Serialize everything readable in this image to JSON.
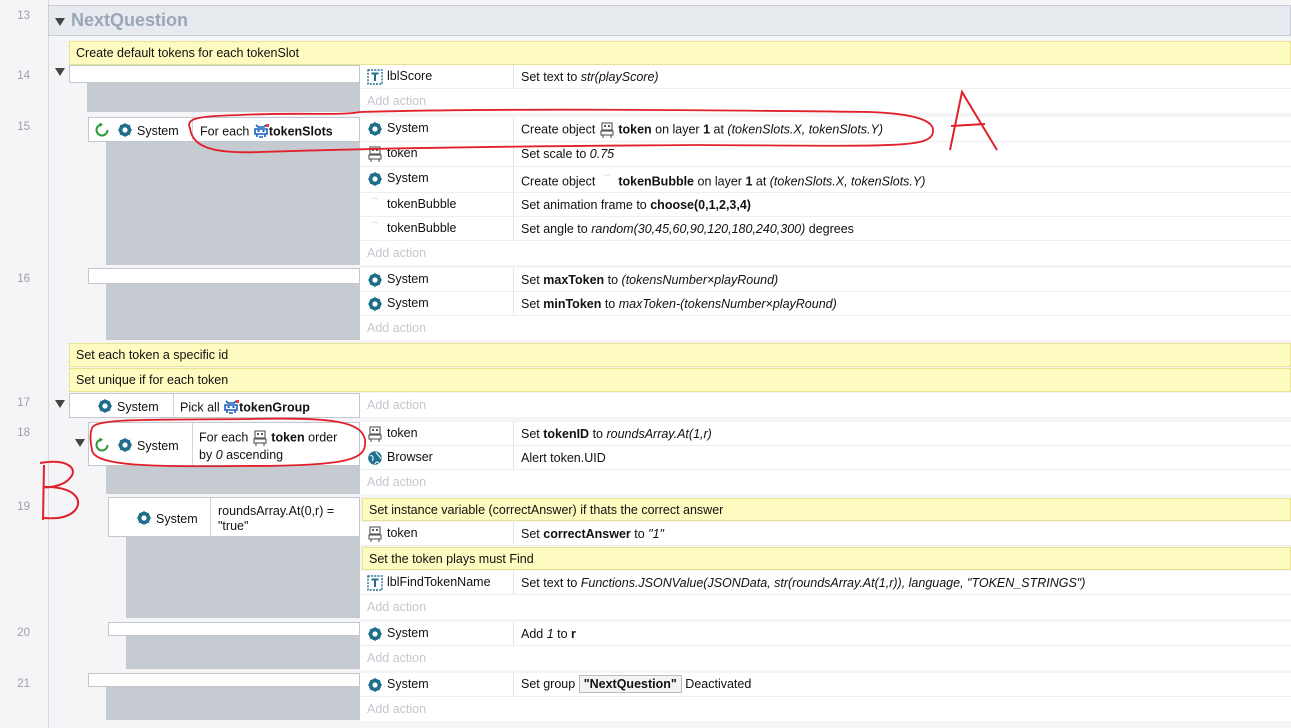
{
  "group": {
    "name": "NextQuestion"
  },
  "lines": [
    "13",
    "14",
    "15",
    "16",
    "17",
    "18",
    "19",
    "20",
    "21"
  ],
  "add_action": "Add action",
  "system": "System",
  "comments": {
    "c1": "Create default tokens for each tokenSlot",
    "c2": "Set each token a specific id",
    "c3": "Set unique if for each token",
    "c4": "Set instance variable (correctAnswer) if thats the correct answer",
    "c5": "Set the token plays must Find"
  },
  "e14": {
    "obj": "lblScore",
    "act_prefix": "Set text to ",
    "act_val": "str(playScore)"
  },
  "e15": {
    "cond_prefix": "For each ",
    "cond_obj": "tokenSlots",
    "rows": [
      {
        "obj": "System",
        "a1": "Create object ",
        "a2": "token",
        "a3": " on layer ",
        "a4": "1",
        "a5": " at ",
        "a6": "(tokenSlots.X, tokenSlots.Y)"
      },
      {
        "obj": "token",
        "a1": "Set scale to ",
        "a2": "0.75"
      },
      {
        "obj": "System",
        "a1": "Create object ",
        "a2": "tokenBubble",
        "a3": " on layer ",
        "a4": "1",
        "a5": " at ",
        "a6": "(tokenSlots.X, tokenSlots.Y)"
      },
      {
        "obj": "tokenBubble",
        "a1": "Set animation frame to ",
        "a2": "choose(0,1,2,3,4)"
      },
      {
        "obj": "tokenBubble",
        "a1": "Set angle to ",
        "a2": "random(30,45,60,90,120,180,240,300)",
        "a3": " degrees"
      }
    ]
  },
  "e16": {
    "rows": [
      {
        "obj": "System",
        "a1": "Set ",
        "a2": "maxToken",
        "a3": " to ",
        "a4": "(tokensNumber×playRound)"
      },
      {
        "obj": "System",
        "a1": "Set ",
        "a2": "minToken",
        "a3": " to ",
        "a4": "maxToken-(tokensNumber×playRound)"
      }
    ]
  },
  "e17": {
    "cond_prefix": "Pick all ",
    "cond_obj": "tokenGroup"
  },
  "e18": {
    "cond1": "For each ",
    "cond_obj": "token",
    "cond2": " order",
    "cond3": "by ",
    "cond4": "0",
    "cond5": " ascending",
    "rows": [
      {
        "obj": "token",
        "a1": "Set ",
        "a2": "tokenID",
        "a3": " to ",
        "a4": "roundsArray.At(1,r)"
      },
      {
        "obj": "Browser",
        "a1": "Alert token.UID"
      }
    ]
  },
  "e19": {
    "cond": "roundsArray.At(0,r) =\n\"true\"",
    "row1": {
      "obj": "token",
      "a1": "Set ",
      "a2": "correctAnswer",
      "a3": " to ",
      "a4": "\"1\""
    },
    "row2": {
      "obj": "lblFindTokenName",
      "a1": "Set text to ",
      "a2": "Functions.JSONValue(JSONData, str(roundsArray.At(1,r)), language, \"TOKEN_STRINGS\")"
    }
  },
  "e20": {
    "obj": "System",
    "a1": "Add ",
    "a2": "1",
    "a3": " to ",
    "a4": "r"
  },
  "e21": {
    "obj": "System",
    "a1": "Set group ",
    "a2": "\"NextQuestion\"",
    "a3": " Deactivated"
  },
  "annotations": {
    "a": "A",
    "b": "B"
  },
  "colors": {
    "comment_bg": "#fdfbbf",
    "event_bg": "#c6cbd2",
    "annotation": "#e0202a",
    "system_icon": "#1f6f8b",
    "loop_icon": "#2e9b3a"
  }
}
